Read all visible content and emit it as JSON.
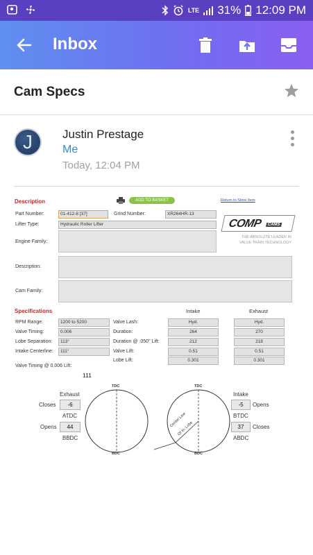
{
  "status_bar": {
    "network": "LTE",
    "battery": "31%",
    "time": "12:09 PM"
  },
  "app_bar": {
    "title": "Inbox"
  },
  "email": {
    "subject": "Cam Specs",
    "sender": "Justin Prestage",
    "recipient": "Me",
    "timestamp": "Today, 12:04 PM",
    "avatar_initial": "J"
  },
  "sheet": {
    "description_heading": "Description",
    "add_to_basket": "ADD TO BASKET",
    "return_link": "Return to Store Item",
    "part_number_label": "Part Number:",
    "part_number": "01-412-8 [37]",
    "grind_number_label": "Grind Number:",
    "grind_number": "XR264HR-13",
    "lifter_type_label": "Lifter Type:",
    "lifter_type": "Hydraulic Roller Lifter",
    "engine_family_label": "Engine Family:",
    "description_label": "Description:",
    "cam_family_label": "Cam Family:",
    "logo_text": "COMP",
    "logo_sub": "CAMS",
    "tagline_1": "THE ABSOLUTE LEADER IN",
    "tagline_2": "VALVE TRAIN TECHNOLOGY",
    "specs_heading": "Specifications",
    "col_intake": "Intake",
    "col_exhaust": "Exhaust",
    "rpm_label": "RPM Range:",
    "rpm": "1200 to 5200",
    "valve_timing_label": "Valve Timing:",
    "valve_timing": "0.006",
    "lobe_sep_label": "Lobe Separation:",
    "lobe_sep": "113°",
    "intake_cl_label": "Intake Centerline:",
    "intake_cl": "111°",
    "valve_lash_label": "Valve Lash:",
    "valve_lash_in": "Hyd.",
    "valve_lash_ex": "Hyd.",
    "duration_label": "Duration:",
    "duration_in": "264",
    "duration_ex": "270",
    "duration050_label": "Duration @ .050\" Lift:",
    "duration050_in": "212",
    "duration050_ex": "218",
    "valve_lift_label": "Valve Lift:",
    "valve_lift_in": "0.51",
    "valve_lift_ex": "0.51",
    "lobe_lift_label": "Lobe Lift:",
    "lobe_lift_in": "0.301",
    "lobe_lift_ex": "0.301",
    "vt_lift_label": "Valve Timing @ 0.006  Lift:",
    "vt_lift_value": "111"
  },
  "timing": {
    "exhaust_label": "Exhaust",
    "closes_label": "Closes",
    "exhaust_closes": "-6",
    "atdc": "ATDC",
    "opens_label": "Opens",
    "exhaust_opens": "44",
    "bbdc": "BBDC",
    "tdc": "TDC",
    "bdc": "BDC",
    "center_line_1": "Center Line",
    "center_line_2": "Of In. Lobe",
    "intake_label": "Intake",
    "intake_opens": "-5",
    "opens_label_r": "Opens",
    "btdc": "BTDC",
    "intake_closes": "37",
    "closes_label_r": "Closes",
    "abdc": "ABDC"
  }
}
